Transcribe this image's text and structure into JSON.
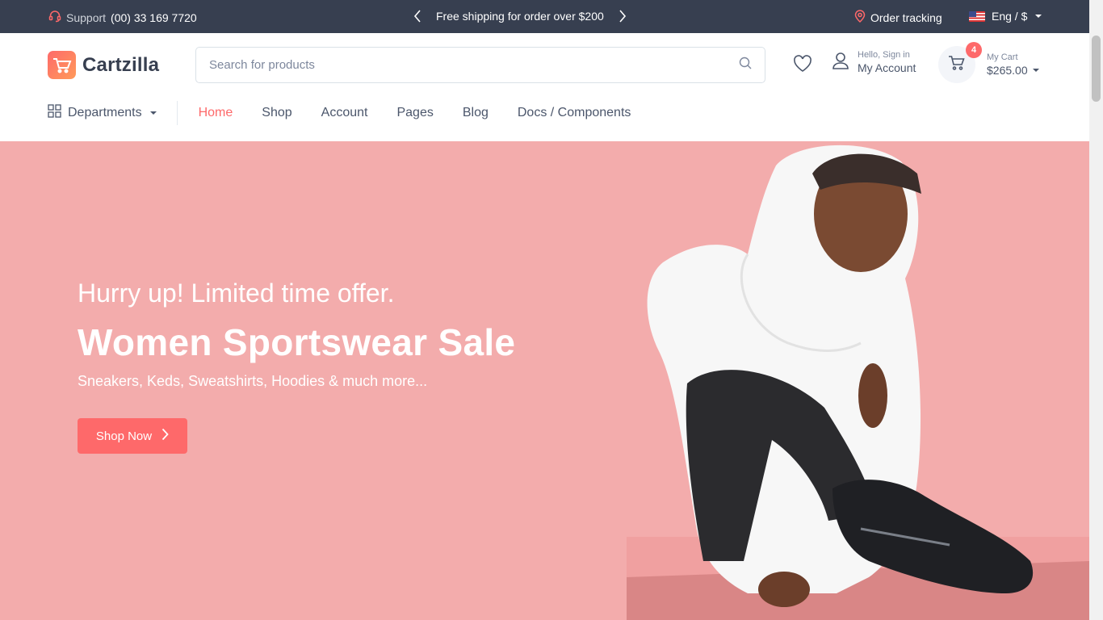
{
  "topbar": {
    "support_label": "Support",
    "support_number": "(00) 33 169 7720",
    "promo": "Free shipping for order over $200",
    "order_tracking": "Order tracking",
    "language": "Eng / $"
  },
  "header": {
    "brand": "Cartzilla",
    "search_placeholder": "Search for products",
    "account_small": "Hello, Sign in",
    "account_label": "My Account",
    "cart_small": "My Cart",
    "cart_total": "$265.00",
    "cart_count": "4"
  },
  "nav": {
    "departments": "Departments",
    "items": [
      "Home",
      "Shop",
      "Account",
      "Pages",
      "Blog",
      "Docs / Components"
    ]
  },
  "hero": {
    "subtitle": "Hurry up! Limited time offer.",
    "title": "Women Sportswear Sale",
    "description": "Sneakers, Keds, Sweatshirts, Hoodies & much more...",
    "cta": "Shop Now"
  },
  "colors": {
    "accent": "#fe696a",
    "topbar_bg": "#373f50",
    "hero_bg": "#f3acac"
  }
}
